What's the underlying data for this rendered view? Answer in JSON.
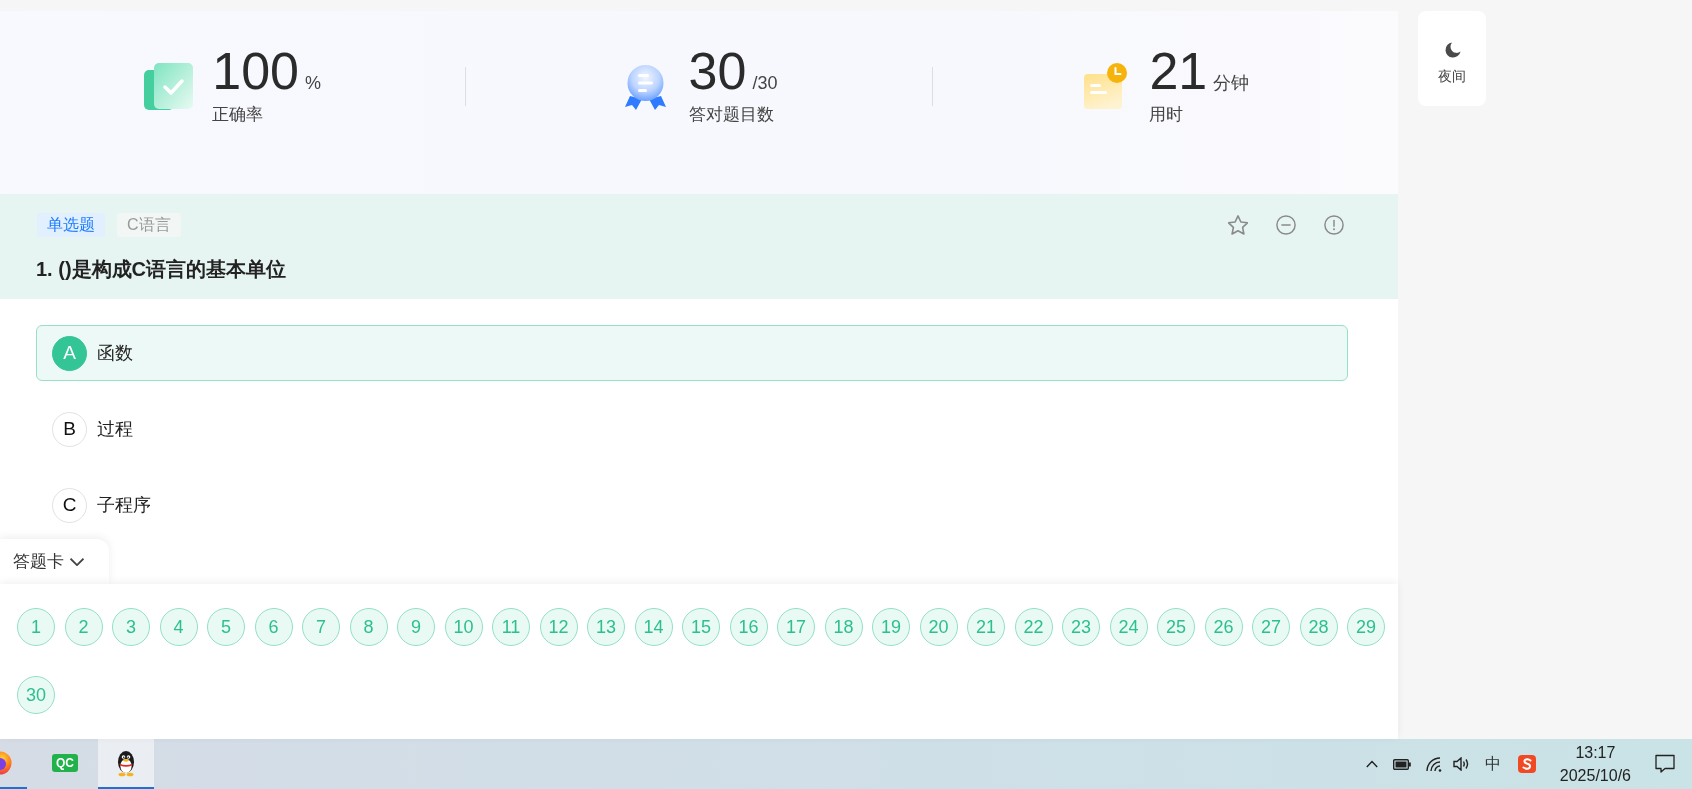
{
  "stats": [
    {
      "kind": "accuracy",
      "value": "100",
      "unit": "%",
      "label": "正确率"
    },
    {
      "kind": "correct_count",
      "value": "30",
      "unit": "/30",
      "label": "答对题目数"
    },
    {
      "kind": "time",
      "value": "21",
      "unit": "分钟",
      "label": "用时"
    }
  ],
  "night_mode_button": {
    "label": "夜间"
  },
  "question": {
    "tags": [
      {
        "kind": "type",
        "text": "单选题"
      },
      {
        "kind": "subject",
        "text": "C语言"
      }
    ],
    "title": "1. ()是构成C语言的基本单位",
    "options": [
      {
        "letter": "A",
        "text": "函数",
        "selected": true
      },
      {
        "letter": "B",
        "text": "过程",
        "selected": false
      },
      {
        "letter": "C",
        "text": "子程序",
        "selected": false
      }
    ]
  },
  "answer_card": {
    "label": "答题卡",
    "expanded": true,
    "numbers": [
      {
        "label": "1",
        "correct": true
      },
      {
        "label": "2",
        "correct": true
      },
      {
        "label": "3",
        "correct": true
      },
      {
        "label": "4",
        "correct": true
      },
      {
        "label": "5",
        "correct": true
      },
      {
        "label": "6",
        "correct": true
      },
      {
        "label": "7",
        "correct": true
      },
      {
        "label": "8",
        "correct": true
      },
      {
        "label": "9",
        "correct": true
      },
      {
        "label": "10",
        "correct": true
      },
      {
        "label": "11",
        "correct": true
      },
      {
        "label": "12",
        "correct": true
      },
      {
        "label": "13",
        "correct": true
      },
      {
        "label": "14",
        "correct": true
      },
      {
        "label": "15",
        "correct": true
      },
      {
        "label": "16",
        "correct": true
      },
      {
        "label": "17",
        "correct": true
      },
      {
        "label": "18",
        "correct": true
      },
      {
        "label": "19",
        "correct": true
      },
      {
        "label": "20",
        "correct": true
      },
      {
        "label": "21",
        "correct": true
      },
      {
        "label": "22",
        "correct": true
      },
      {
        "label": "23",
        "correct": true
      },
      {
        "label": "24",
        "correct": true
      },
      {
        "label": "25",
        "correct": true
      },
      {
        "label": "26",
        "correct": true
      },
      {
        "label": "27",
        "correct": true
      },
      {
        "label": "28",
        "correct": true
      },
      {
        "label": "29",
        "correct": true
      },
      {
        "label": "30",
        "correct": true
      }
    ]
  },
  "taskbar": {
    "apps": [
      {
        "kind": "browser",
        "running": true,
        "active": false
      },
      {
        "kind": "qc",
        "label": "QC",
        "running": false,
        "active": false
      },
      {
        "kind": "penguin",
        "running": true,
        "active": true
      }
    ],
    "ime": "中",
    "time": "13:17",
    "date": "2025/10/6"
  }
}
